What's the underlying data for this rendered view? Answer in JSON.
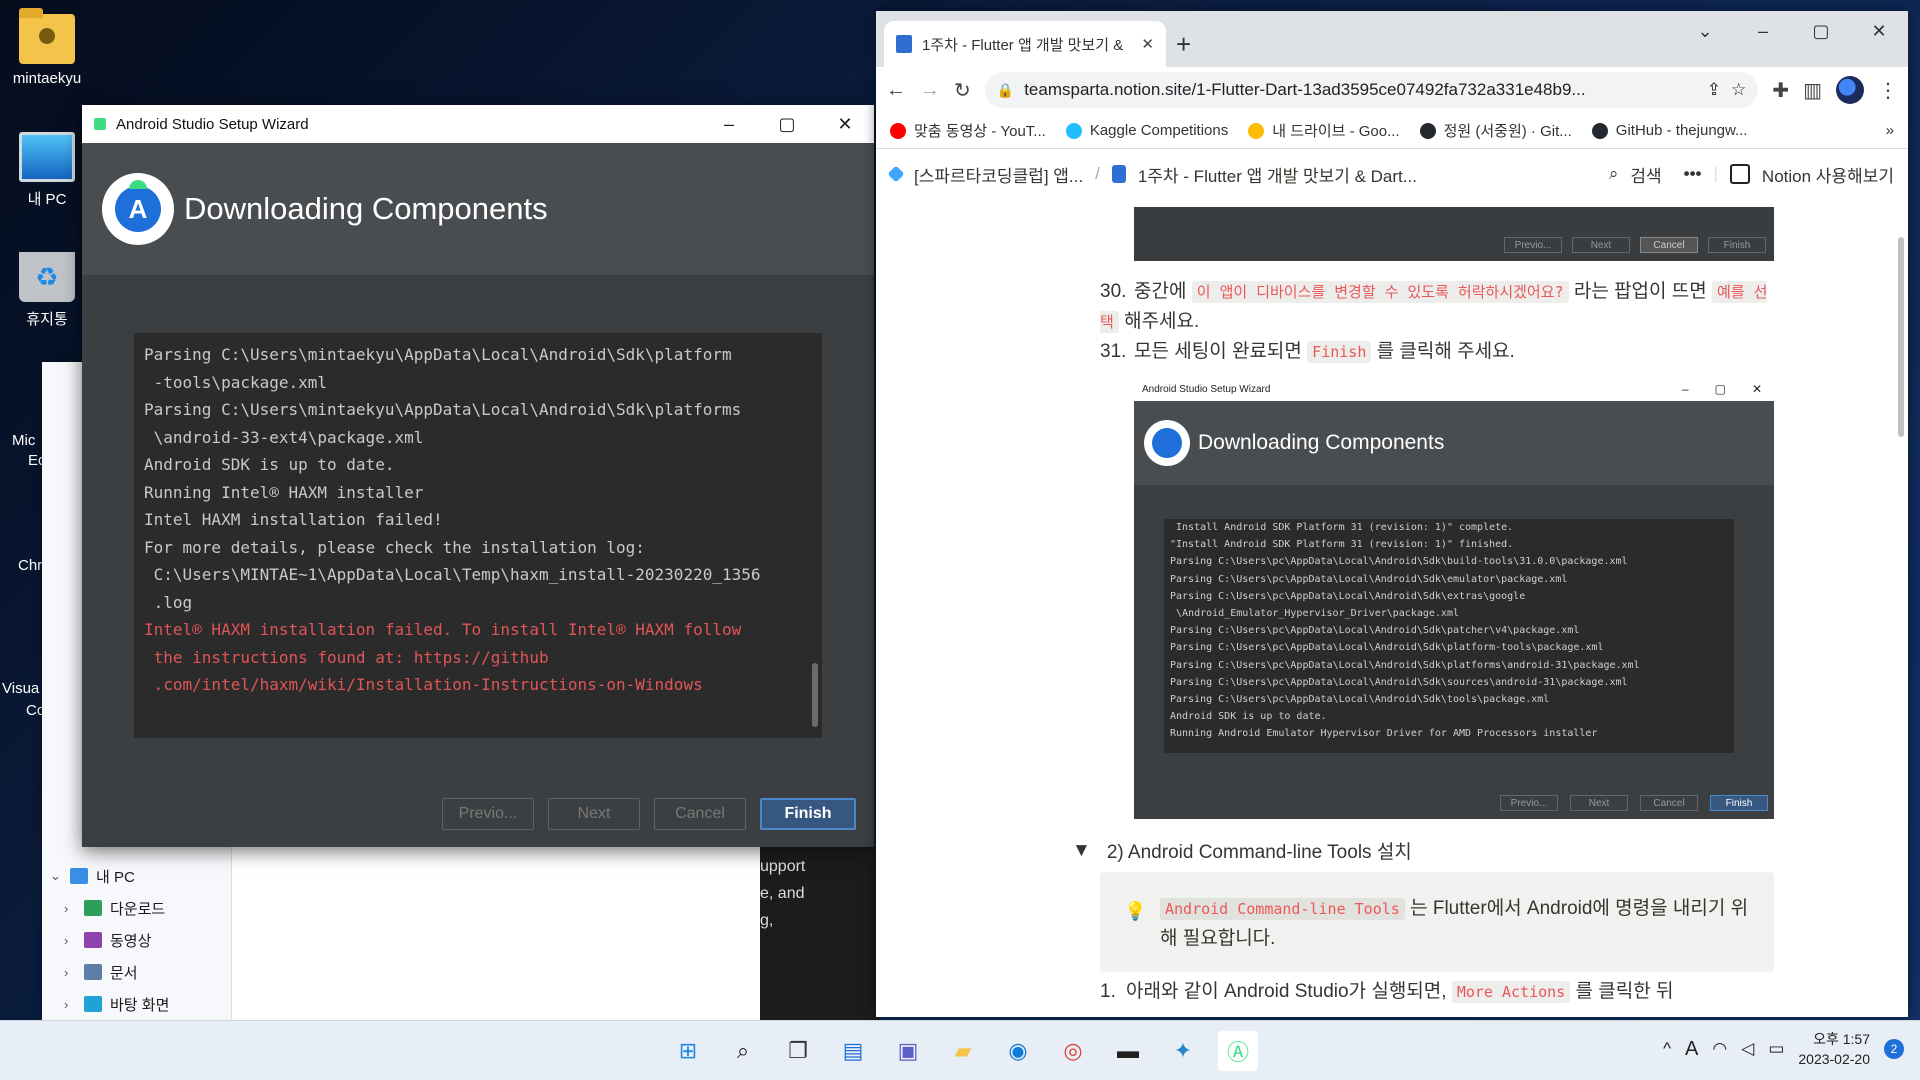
{
  "desktop": {
    "icons": [
      {
        "label": "mintaekyu"
      },
      {
        "label": "내 PC"
      },
      {
        "label": "휴지통"
      }
    ],
    "partial_icon_labels": [
      "Mic",
      "Ec",
      "Chr",
      "Visua",
      "Cc"
    ]
  },
  "explorer": {
    "tree": [
      {
        "label": "내 PC"
      },
      {
        "label": "다운로드"
      },
      {
        "label": "동영상"
      },
      {
        "label": "문서"
      },
      {
        "label": "바탕 화면"
      }
    ],
    "dark_pane_lines": [
      "upport",
      "e, and",
      "g,"
    ]
  },
  "wizard": {
    "window_title": "Android Studio Setup Wizard",
    "heading": "Downloading Components",
    "log_lines": [
      {
        "text": "Parsing C:\\Users\\mintaekyu\\AppData\\Local\\Android\\Sdk\\platform",
        "error": false
      },
      {
        "text": " -tools\\package.xml",
        "error": false
      },
      {
        "text": "Parsing C:\\Users\\mintaekyu\\AppData\\Local\\Android\\Sdk\\platforms",
        "error": false
      },
      {
        "text": " \\android-33-ext4\\package.xml",
        "error": false
      },
      {
        "text": "Android SDK is up to date.",
        "error": false
      },
      {
        "text": "Running Intel® HAXM installer",
        "error": false
      },
      {
        "text": "Intel HAXM installation failed!",
        "error": false
      },
      {
        "text": "For more details, please check the installation log:",
        "error": false
      },
      {
        "text": " C:\\Users\\MINTAE~1\\AppData\\Local\\Temp\\haxm_install-20230220_1356",
        "error": false
      },
      {
        "text": " .log",
        "error": false
      },
      {
        "text": "Intel® HAXM installation failed. To install Intel® HAXM follow",
        "error": true
      },
      {
        "text": " the instructions found at: https://github",
        "error": true
      },
      {
        "text": " .com/intel/haxm/wiki/Installation-Instructions-on-Windows",
        "error": true
      }
    ],
    "buttons": {
      "previous": "Previo...",
      "next": "Next",
      "cancel": "Cancel",
      "finish": "Finish"
    }
  },
  "browser": {
    "tab_title": "1주차 - Flutter 앱 개발 맛보기 & ",
    "url": "teamsparta.notion.site/1-Flutter-Dart-13ad3595ce07492fa732a331e48b9...",
    "bookmarks": [
      {
        "label": "맞춤 동영상 - YouT...",
        "color": "#ff0000"
      },
      {
        "label": "Kaggle Competitions",
        "color": "#20beff"
      },
      {
        "label": "내 드라이브 - Goo...",
        "color": "#fbbc04"
      },
      {
        "label": "정원 (서중원) · Git...",
        "color": "#24292f"
      },
      {
        "label": "GitHub - thejungw...",
        "color": "#24292f"
      }
    ],
    "more_bookmarks": "»"
  },
  "notion": {
    "breadcrumb_1": "[스파르타코딩클럽] 앱...",
    "breadcrumb_sep": "/",
    "breadcrumb_2": "1주차 - Flutter 앱 개발 맛보기 & Dart...",
    "search_label": "검색",
    "more_label": "•••",
    "try_notion": "Notion 사용해보기",
    "shot_top_buttons": [
      "Previo...",
      "Next",
      "Cancel",
      "Finish"
    ],
    "step30": {
      "num": "30.",
      "pre": "중간에 ",
      "code": "이 앱이 디바이스를 변경할 수 있도록 허락하시겠어요?",
      "mid": " 라는 팝업이 뜨면 ",
      "code2": "예를 선택",
      "post": " 해주세요."
    },
    "step31": {
      "num": "31.",
      "pre": "모든 세팅이 완료되면 ",
      "code": "Finish",
      "post": " 를 클릭해 주세요."
    },
    "shot": {
      "title": "Android Studio Setup Wizard",
      "heading": "Downloading Components",
      "controls": [
        "–",
        "▢",
        "✕"
      ],
      "log": [
        " Install Android SDK Platform 31 (revision: 1)\" complete.",
        "\"Install Android SDK Platform 31 (revision: 1)\" finished.",
        "Parsing C:\\Users\\pc\\AppData\\Local\\Android\\Sdk\\build-tools\\31.0.0\\package.xml",
        "Parsing C:\\Users\\pc\\AppData\\Local\\Android\\Sdk\\emulator\\package.xml",
        "Parsing C:\\Users\\pc\\AppData\\Local\\Android\\Sdk\\extras\\google",
        " \\Android_Emulator_Hypervisor_Driver\\package.xml",
        "Parsing C:\\Users\\pc\\AppData\\Local\\Android\\Sdk\\patcher\\v4\\package.xml",
        "Parsing C:\\Users\\pc\\AppData\\Local\\Android\\Sdk\\platform-tools\\package.xml",
        "Parsing C:\\Users\\pc\\AppData\\Local\\Android\\Sdk\\platforms\\android-31\\package.xml",
        "Parsing C:\\Users\\pc\\AppData\\Local\\Android\\Sdk\\sources\\android-31\\package.xml",
        "Parsing C:\\Users\\pc\\AppData\\Local\\Android\\Sdk\\tools\\package.xml",
        "Android SDK is up to date.",
        "Running Android Emulator Hypervisor Driver for AMD Processors installer"
      ],
      "buttons": [
        "Previo...",
        "Next",
        "Cancel",
        "Finish"
      ]
    },
    "toggle_heading": "2) Android Command-line Tools 설치",
    "toggle_arrow": "▼",
    "callout": {
      "code": "Android Command-line Tools",
      "text": " 는 Flutter에서 Android에 명령을 내리기 위해 필요합니다."
    },
    "step1": {
      "num": "1.",
      "pre": "아래와 같이 Android Studio가 실행되면, ",
      "code": "More Actions",
      "post": " 를 클릭한 뒤"
    }
  },
  "taskbar": {
    "apps": [
      {
        "name": "start-button",
        "glyph": "⊞"
      },
      {
        "name": "search-button",
        "glyph": "⌕"
      },
      {
        "name": "task-view-button",
        "glyph": "❐"
      },
      {
        "name": "widgets-button",
        "glyph": "▤"
      },
      {
        "name": "teams-chat-button",
        "glyph": "▣"
      },
      {
        "name": "file-explorer-button",
        "glyph": "▰"
      },
      {
        "name": "edge-button",
        "glyph": "◉"
      },
      {
        "name": "chrome-button",
        "glyph": "◎"
      },
      {
        "name": "terminal-button",
        "glyph": "▬"
      },
      {
        "name": "vscode-button",
        "glyph": "✦"
      },
      {
        "name": "android-studio-button",
        "glyph": "Ⓐ"
      }
    ],
    "tray_chevron": "^",
    "ime": "A",
    "clock_time": "오후 1:57",
    "clock_date": "2023-02-20",
    "notification_count": "2"
  }
}
